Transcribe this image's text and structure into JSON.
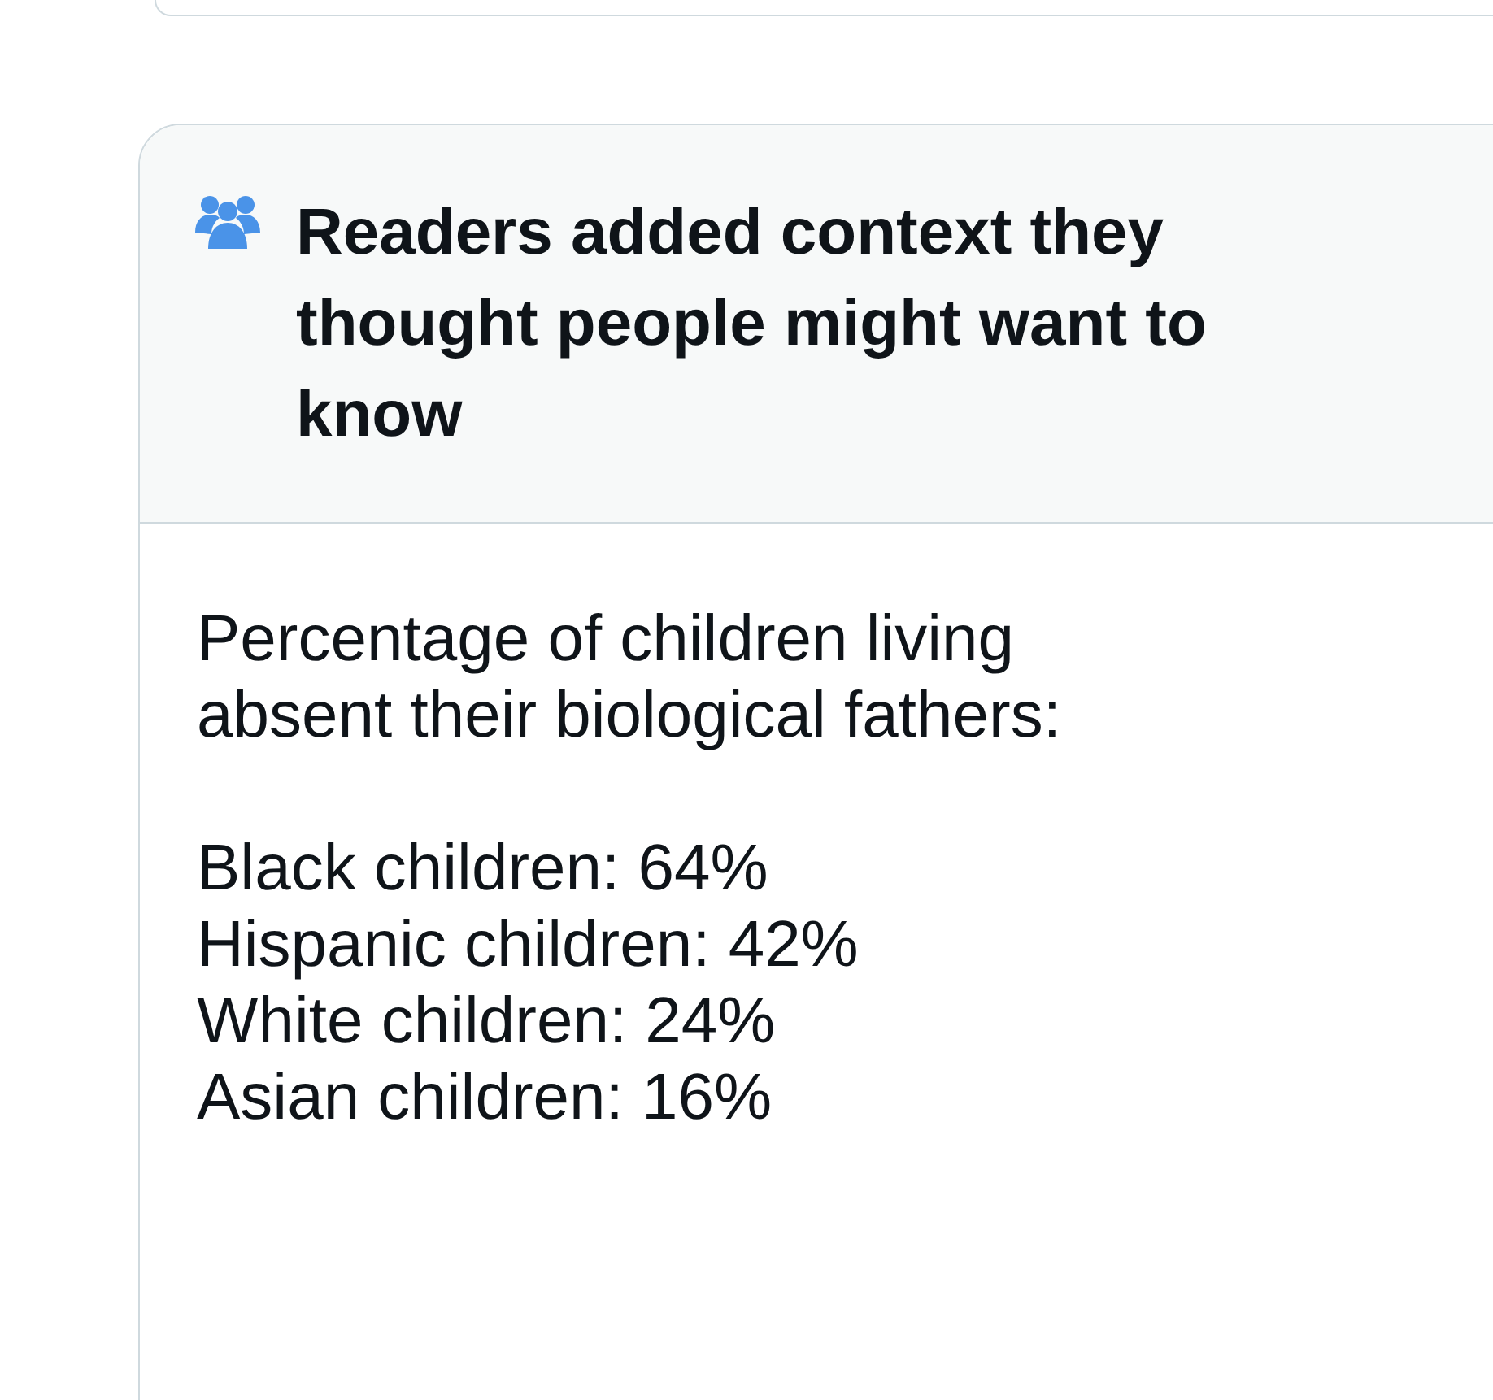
{
  "note": {
    "title": "Readers added context they thought people might want to know",
    "intro": "Percentage of children living absent their biological fathers:",
    "lines": [
      "Black children: 64%",
      "Hispanic children: 42%",
      "White children: 24%",
      "Asian children: 16%"
    ]
  }
}
